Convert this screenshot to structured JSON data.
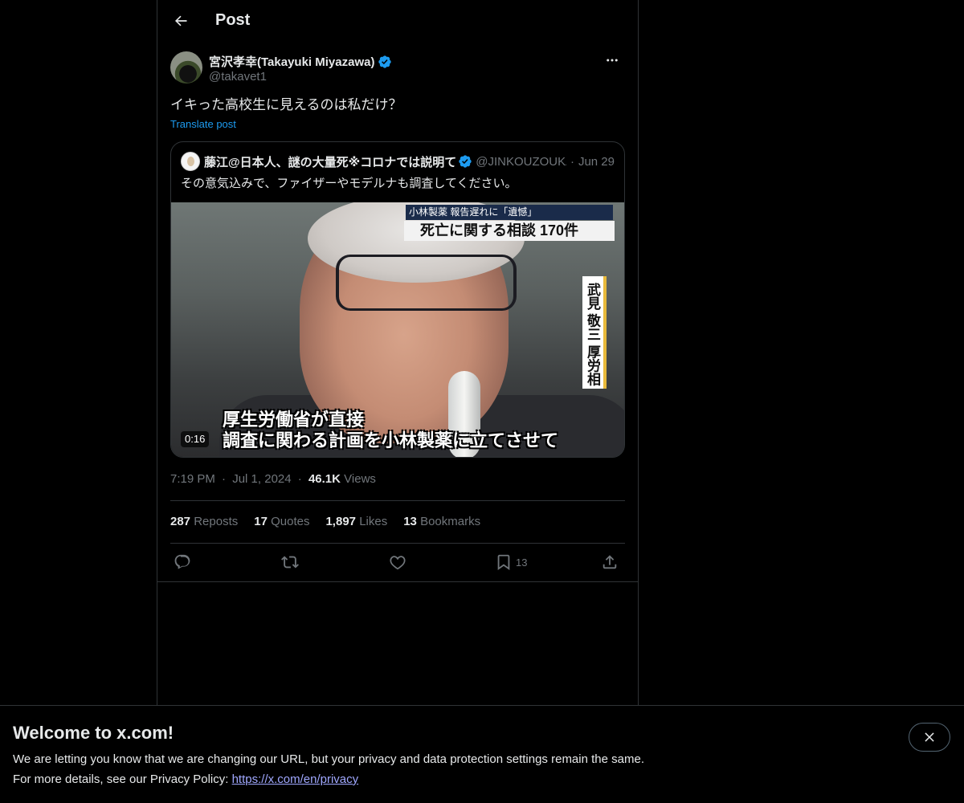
{
  "header": {
    "title": "Post"
  },
  "post": {
    "author_name": "宮沢孝幸(Takayuki Miyazawa)",
    "handle": "@takavet1",
    "text": "イキった高校生に見えるのは私だけ？",
    "translate_label": "Translate post",
    "time": "7:19 PM",
    "date": "Jul 1, 2024",
    "views_count": "46.1K",
    "views_label": "Views",
    "separator": "·"
  },
  "quote": {
    "author_name": "藤江@日本人、謎の大量死※コロナでは説明て",
    "handle": "@JINKOUZOUKA",
    "separator": "·",
    "date": "Jun 29",
    "text": "その意気込みで、ファイザーやモデルナも調査してください。",
    "video": {
      "caption_top": "小林製薬 報告遅れに「遺憾」",
      "caption_main": "死亡に関する相談 170件",
      "name_strip": "武見 敬三 厚労相",
      "subtitle_line1": "厚生労働省が直接",
      "subtitle_line2": "調査に関わる計画を小林製薬に立てさせて",
      "duration": "0:16"
    }
  },
  "stats": {
    "reposts_count": "287",
    "reposts_label": "Reposts",
    "quotes_count": "17",
    "quotes_label": "Quotes",
    "likes_count": "1,897",
    "likes_label": "Likes",
    "bookmarks_count": "13",
    "bookmarks_label": "Bookmarks"
  },
  "actions": {
    "bookmark_count": "13"
  },
  "banner": {
    "title": "Welcome to x.com!",
    "line1": "We are letting you know that we are changing our URL, but your privacy and data protection settings remain the same.",
    "line2_prefix": "For more details, see our Privacy Policy: ",
    "link": "https://x.com/en/privacy"
  },
  "colors": {
    "accent": "#1d9bf0",
    "background": "#000000",
    "text": "#e7e9ea",
    "muted": "#71767b",
    "border": "#2f3336"
  },
  "icons": [
    "back-arrow-icon",
    "verified-badge-icon",
    "more-icon",
    "reply-icon",
    "repost-icon",
    "like-icon",
    "bookmark-icon",
    "share-icon",
    "close-icon"
  ]
}
